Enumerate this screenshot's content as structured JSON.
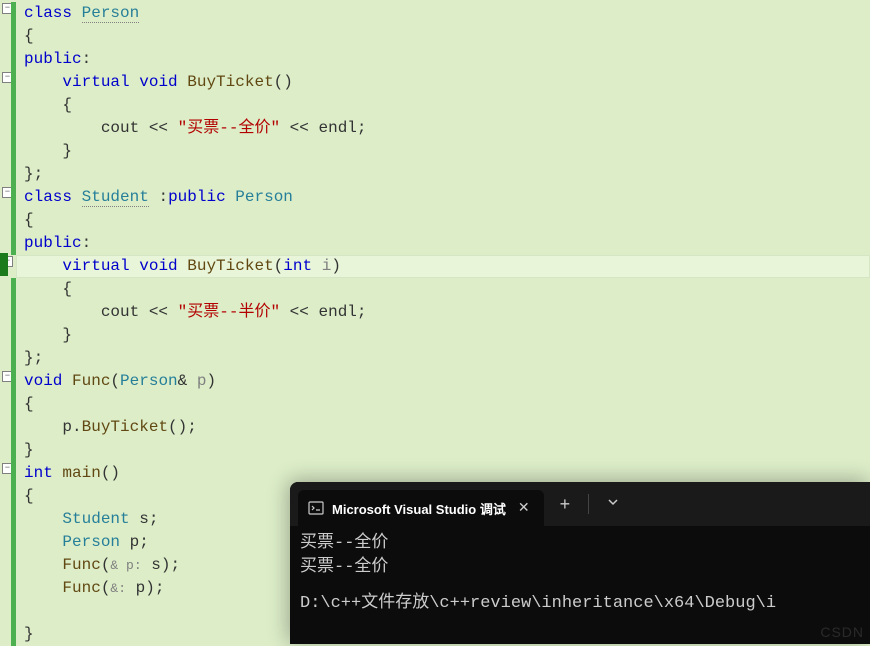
{
  "editor": {
    "lines": {
      "l1_class": "class",
      "l1_type": "Person",
      "l2_brace": "{",
      "l3_public": "public",
      "l3_colon": ":",
      "l4_virtual": "virtual",
      "l4_void": "void",
      "l4_func": "BuyTicket",
      "l4_parens": "()",
      "l5_brace": "{",
      "l6_cout": "cout",
      "l6_op1": "<<",
      "l6_str": "\"买票--全价\"",
      "l6_op2": "<<",
      "l6_endl": "endl",
      "l6_semi": ";",
      "l7_brace": "}",
      "l8_close": "};",
      "l9_class": "class",
      "l9_type": "Student",
      "l9_colon": ":",
      "l9_public": "public",
      "l9_base": "Person",
      "l10_brace": "{",
      "l11_public": "public",
      "l11_colon": ":",
      "l12_virtual": "virtual",
      "l12_void": "void",
      "l12_func": "BuyTicket",
      "l12_lparen": "(",
      "l12_int": "int",
      "l12_param": "i",
      "l12_rparen": ")",
      "l13_brace": "{",
      "l14_cout": "cout",
      "l14_op1": "<<",
      "l14_str": "\"买票--半价\"",
      "l14_op2": "<<",
      "l14_endl": "endl",
      "l14_semi": ";",
      "l15_brace": "}",
      "l16_close": "};",
      "l17_void": "void",
      "l17_func": "Func",
      "l17_lparen": "(",
      "l17_type": "Person",
      "l17_amp": "&",
      "l17_param": "p",
      "l17_rparen": ")",
      "l18_brace": "{",
      "l19_p": "p",
      "l19_dot": ".",
      "l19_func": "BuyTicket",
      "l19_call": "();",
      "l20_brace": "}",
      "l21_int": "int",
      "l21_main": "main",
      "l21_parens": "()",
      "l22_brace": "{",
      "l23_type": "Student",
      "l23_var": "s",
      "l23_semi": ";",
      "l24_type": "Person",
      "l24_var": "p",
      "l24_semi": ";",
      "l25_func": "Func",
      "l25_lparen": "(",
      "l25_hint": "& p:",
      "l25_arg": "s",
      "l25_rparen": ");",
      "l26_func": "Func",
      "l26_lparen": "(",
      "l26_hint": "&:",
      "l26_arg": "p",
      "l26_rparen": ");",
      "l28_brace": "}"
    },
    "fold_minus": "−",
    "fold_plus": "−"
  },
  "terminal": {
    "tab_title": "Microsoft Visual Studio 调试",
    "output_line_1": "买票--全价",
    "output_line_2": "买票--全价",
    "path_line": "D:\\c++文件存放\\c++review\\inheritance\\x64\\Debug\\i",
    "watermark": "CSDN"
  }
}
